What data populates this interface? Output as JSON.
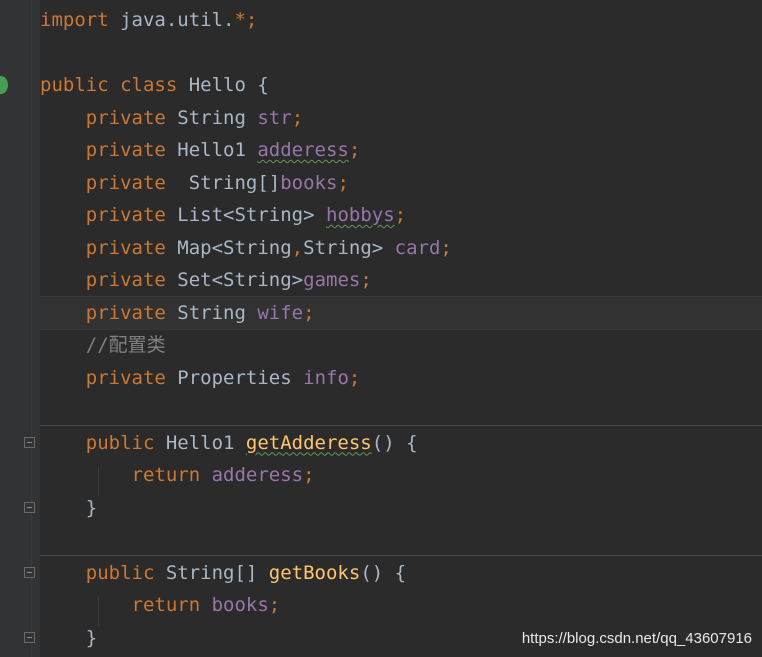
{
  "editor": {
    "lines": [
      {
        "indent": "",
        "parts": [
          [
            "kw",
            "import "
          ],
          [
            "",
            "java.util."
          ],
          [
            "kw",
            "*"
          ],
          [
            "kw",
            ";"
          ]
        ]
      },
      {
        "indent": "",
        "parts": []
      },
      {
        "indent": "",
        "parts": [
          [
            "kw",
            "public "
          ],
          [
            "kw",
            "class "
          ],
          [
            "",
            "Hello {"
          ]
        ]
      },
      {
        "indent": "    ",
        "parts": [
          [
            "kw",
            "private "
          ],
          [
            "",
            "String "
          ],
          [
            "fld",
            "str"
          ],
          [
            "kw",
            ";"
          ]
        ]
      },
      {
        "indent": "    ",
        "parts": [
          [
            "kw",
            "private "
          ],
          [
            "",
            "Hello1 "
          ],
          [
            "fld typo",
            "adderess"
          ],
          [
            "kw",
            ";"
          ]
        ]
      },
      {
        "indent": "    ",
        "parts": [
          [
            "kw",
            "private "
          ],
          [
            "",
            " String[]"
          ],
          [
            "fld",
            "books"
          ],
          [
            "kw",
            ";"
          ]
        ]
      },
      {
        "indent": "    ",
        "parts": [
          [
            "kw",
            "private "
          ],
          [
            "",
            "List<String> "
          ],
          [
            "fld typo",
            "hobbys"
          ],
          [
            "kw",
            ";"
          ]
        ]
      },
      {
        "indent": "    ",
        "parts": [
          [
            "kw",
            "private "
          ],
          [
            "",
            "Map<String"
          ],
          [
            "kw",
            ","
          ],
          [
            "",
            "String> "
          ],
          [
            "fld",
            "card"
          ],
          [
            "kw",
            ";"
          ]
        ]
      },
      {
        "indent": "    ",
        "parts": [
          [
            "kw",
            "private "
          ],
          [
            "",
            "Set<String>"
          ],
          [
            "fld",
            "games"
          ],
          [
            "kw",
            ";"
          ]
        ]
      },
      {
        "indent": "    ",
        "parts": [
          [
            "kw",
            "private "
          ],
          [
            "",
            "String "
          ],
          [
            "fld",
            "wife"
          ],
          [
            "kw",
            ";"
          ]
        ]
      },
      {
        "indent": "    ",
        "parts": [
          [
            "cmt",
            "//配置类"
          ]
        ]
      },
      {
        "indent": "    ",
        "parts": [
          [
            "kw",
            "private "
          ],
          [
            "",
            "Properties "
          ],
          [
            "fld",
            "info"
          ],
          [
            "kw",
            ";"
          ]
        ]
      },
      {
        "indent": "",
        "parts": []
      },
      {
        "indent": "    ",
        "parts": [
          [
            "kw",
            "public "
          ],
          [
            "",
            "Hello1 "
          ],
          [
            "mth typo",
            "getAdderess"
          ],
          [
            "",
            "() {"
          ]
        ]
      },
      {
        "indent": "        ",
        "parts": [
          [
            "kw",
            "return "
          ],
          [
            "fld",
            "adderess"
          ],
          [
            "kw",
            ";"
          ]
        ]
      },
      {
        "indent": "    ",
        "parts": [
          [
            "",
            "}"
          ]
        ]
      },
      {
        "indent": "",
        "parts": []
      },
      {
        "indent": "    ",
        "parts": [
          [
            "kw",
            "public "
          ],
          [
            "",
            "String[] "
          ],
          [
            "mth",
            "getBooks"
          ],
          [
            "",
            "() {"
          ]
        ]
      },
      {
        "indent": "        ",
        "parts": [
          [
            "kw",
            "return "
          ],
          [
            "fld",
            "books"
          ],
          [
            "kw",
            ";"
          ]
        ]
      },
      {
        "indent": "    ",
        "parts": [
          [
            "",
            "}"
          ]
        ]
      }
    ]
  },
  "watermark": "https://blog.csdn.net/qq_43607916",
  "colors": {
    "background": "#2b2b2b",
    "keyword": "#cc7832",
    "field": "#9876aa",
    "method": "#ffc66d",
    "comment": "#808080",
    "text": "#a9b7c6"
  },
  "icons": [
    "run-gutter-icon",
    "fold-icon"
  ]
}
